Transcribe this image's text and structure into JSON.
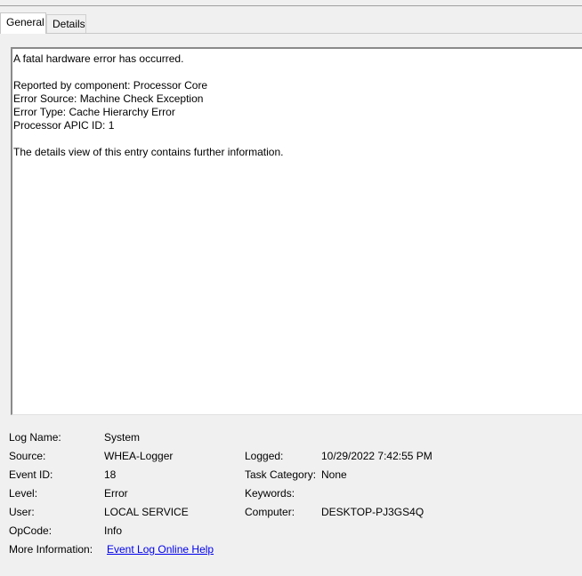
{
  "tabs": [
    {
      "label": "General",
      "active": true
    },
    {
      "label": "Details",
      "active": false
    }
  ],
  "description": {
    "lines": [
      "A fatal hardware error has occurred.",
      "",
      "Reported by component: Processor Core",
      "Error Source: Machine Check Exception",
      "Error Type: Cache Hierarchy Error",
      "Processor APIC ID: 1",
      "",
      "The details view of this entry contains further information."
    ]
  },
  "properties": {
    "log_name_label": "Log Name:",
    "log_name_value": "System",
    "source_label": "Source:",
    "source_value": "WHEA-Logger",
    "logged_label": "Logged:",
    "logged_value": "10/29/2022 7:42:55 PM",
    "event_id_label": "Event ID:",
    "event_id_value": "18",
    "task_category_label": "Task Category:",
    "task_category_value": "None",
    "level_label": "Level:",
    "level_value": "Error",
    "keywords_label": "Keywords:",
    "keywords_value": "",
    "user_label": "User:",
    "user_value": "LOCAL SERVICE",
    "computer_label": "Computer:",
    "computer_value": "DESKTOP-PJ3GS4Q",
    "opcode_label": "OpCode:",
    "opcode_value": "Info",
    "more_info_label": "More Information:",
    "more_info_link": "Event Log Online Help"
  },
  "colors": {
    "background": "#f0f0f0",
    "link": "#0000ee",
    "panel": "#ffffff"
  }
}
